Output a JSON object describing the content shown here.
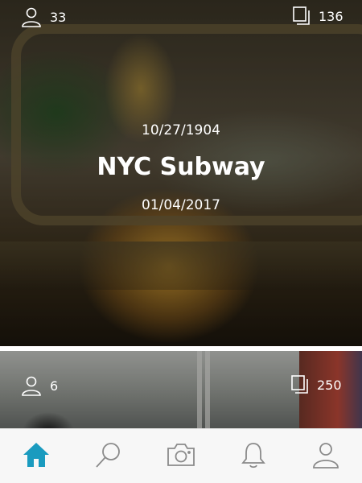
{
  "feed": [
    {
      "followers": "33",
      "photos": "136",
      "start_date": "10/27/1904",
      "title": "NYC Subway",
      "end_date": "01/04/2017"
    },
    {
      "followers": "6",
      "photos": "250"
    }
  ],
  "tabbar": {
    "accent_color": "#1a9bbf",
    "inactive_color": "#8a8a8a",
    "items": [
      "home-icon",
      "search-icon",
      "camera-icon",
      "bell-icon",
      "profile-icon"
    ],
    "active": "home-icon"
  }
}
